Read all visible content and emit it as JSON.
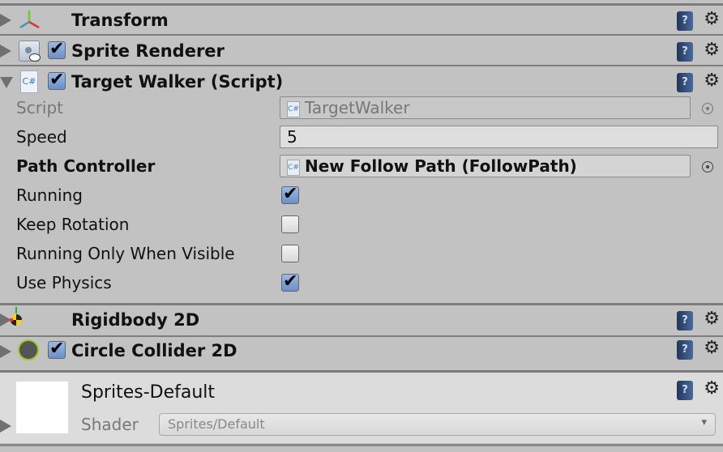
{
  "components": [
    {
      "title": "Transform",
      "icon": "transform-axes-icon",
      "expanded": false,
      "has_checkbox": false
    },
    {
      "title": "Sprite Renderer",
      "icon": "sprite-renderer-icon",
      "expanded": false,
      "has_checkbox": true,
      "enabled": true
    },
    {
      "title": "Target Walker (Script)",
      "icon": "csharp-script-icon",
      "expanded": true,
      "has_checkbox": true,
      "enabled": true
    },
    {
      "title": "Rigidbody 2D",
      "icon": "rigidbody-2d-icon",
      "expanded": false,
      "has_checkbox": false
    },
    {
      "title": "Circle Collider 2D",
      "icon": "circle-collider-icon",
      "expanded": false,
      "has_checkbox": true,
      "enabled": true
    }
  ],
  "target_walker": {
    "script": {
      "label": "Script",
      "value": "TargetWalker"
    },
    "speed": {
      "label": "Speed",
      "value": "5"
    },
    "path_controller": {
      "label": "Path Controller",
      "value": "New Follow Path (FollowPath)"
    },
    "running": {
      "label": "Running",
      "checked": true
    },
    "keep_rotation": {
      "label": "Keep Rotation",
      "checked": false
    },
    "running_only_when_visible": {
      "label": "Running Only When Visible",
      "checked": false
    },
    "use_physics": {
      "label": "Use Physics",
      "checked": true
    }
  },
  "material": {
    "name": "Sprites-Default",
    "shader_label": "Shader",
    "shader_value": "Sprites/Default"
  },
  "icons": {
    "help": "?",
    "gear": "⚙",
    "dropdown": "▾"
  },
  "colors": {
    "panel": "#c2c2c2",
    "material_bg": "#dcdcdc",
    "checkbox_on": "#7a9bd0"
  }
}
